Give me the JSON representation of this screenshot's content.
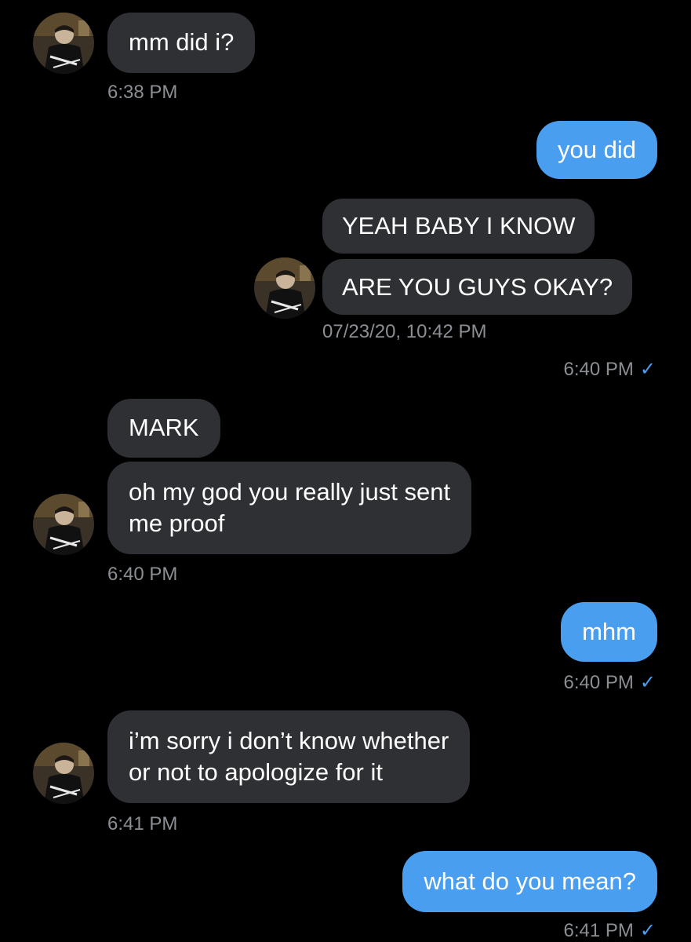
{
  "colors": {
    "background": "#000000",
    "incoming_bubble": "#2f3033",
    "outgoing_bubble": "#4a9ef0",
    "timestamp": "#8b8e93",
    "read_check": "#4a9ef0"
  },
  "messages": {
    "m1": {
      "text": "mm did i?",
      "time": "6:38 PM"
    },
    "m2": {
      "text": "you did"
    },
    "quoted": {
      "line1": "YEAH BABY I KNOW",
      "line2": "ARE YOU GUYS OKAY?",
      "time": "07/23/20, 10:42 PM"
    },
    "m2_time": "6:40 PM",
    "m3": {
      "text": "MARK"
    },
    "m4": {
      "line1": "oh my god you really just sent",
      "line2": "me proof",
      "time": "6:40 PM"
    },
    "m5": {
      "text": "mhm",
      "time": "6:40 PM"
    },
    "m6": {
      "line1": "i’m sorry i don’t know whether",
      "line2": "or not to apologize for it",
      "time": "6:41 PM"
    },
    "m7": {
      "text": "what do you mean?",
      "time": "6:41 PM"
    }
  },
  "icons": {
    "read_check": "✓",
    "avatar": "avatar-photo-icon"
  }
}
